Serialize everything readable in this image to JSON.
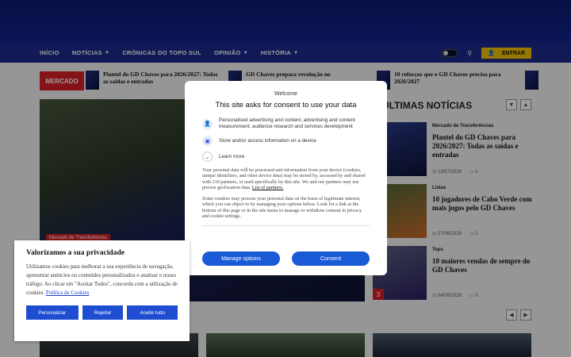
{
  "nav": {
    "items": [
      {
        "label": "INÍCIO",
        "dropdown": false
      },
      {
        "label": "NOTÍCIAS",
        "dropdown": true
      },
      {
        "label": "CRÓNICAS DO TOPO SUL",
        "dropdown": false
      },
      {
        "label": "OPINIÃO",
        "dropdown": true
      },
      {
        "label": "HISTÓRIA",
        "dropdown": true
      }
    ],
    "login_label": "ENTRAR"
  },
  "ticker": {
    "label": "MERCADO",
    "items": [
      "Plantel do GD Chaves para 2026/2027: Todas as saídas e entradas",
      "GD Chaves prepara revolução no",
      "10 reforços que o GD Chaves precisa para 2026/2027"
    ]
  },
  "hero": {
    "tag": "Mercado de Transferências"
  },
  "latest": {
    "title": "ÚLTIMAS NOTÍCIAS",
    "items": [
      {
        "category": "Mercado de Transferências",
        "title": "Plantel do GD Chaves para 2026/2027: Todas as saídas e entradas",
        "date": "13/07/2026",
        "comments": "1",
        "rank": ""
      },
      {
        "category": "Listas",
        "title": "10 jogadores de Cabo Verde com mais jogos pelo GD Chaves",
        "date": "27/06/2026",
        "comments": "1",
        "rank": ""
      },
      {
        "category": "Tops",
        "title": "10 maiores vendas de sempre do GD Chaves",
        "date": "04/06/2026",
        "comments": "0",
        "rank": "3"
      }
    ]
  },
  "consent": {
    "welcome": "Welcome",
    "title": "This site asks for consent to use your data",
    "purpose1": "Personalised advertising and content, advertising and content measurement, audience research and services development",
    "purpose2": "Store and/or access information on a device",
    "learn_more": "Learn more",
    "para1": "Your personal data will be processed and information from your device (cookies, unique identifiers, and other device data) may be stored by, accessed by and shared with 210 partners, or used specifically by this site. We and our partners may use precise geolocation data.",
    "partners_link": "List of partners.",
    "para2": "Some vendors may process your personal data on the basis of legitimate interest, which you can object to by managing your options below. Look for a link at the bottom of this page or in the site menu to manage or withdraw consent in privacy and cookie settings.",
    "manage_label": "Manage options",
    "consent_label": "Consent"
  },
  "privacy": {
    "title": "Valorizamos a sua privacidade",
    "text": "Utilizamos cookies para melhorar a sua experiência de navegação, apresentar anúncios ou conteúdos personalizados e analisar o nosso tráfego. Ao clicar em \"Aceitar Todos\", concorda com a utilização de cookies.",
    "policy_link": "Política de Cookies",
    "customize": "Personalizar",
    "reject": "Rejeitar",
    "accept": "Aceite tudo"
  },
  "icons": {
    "search": "search-icon",
    "user": "user-icon",
    "theme": "theme-toggle-icon"
  }
}
